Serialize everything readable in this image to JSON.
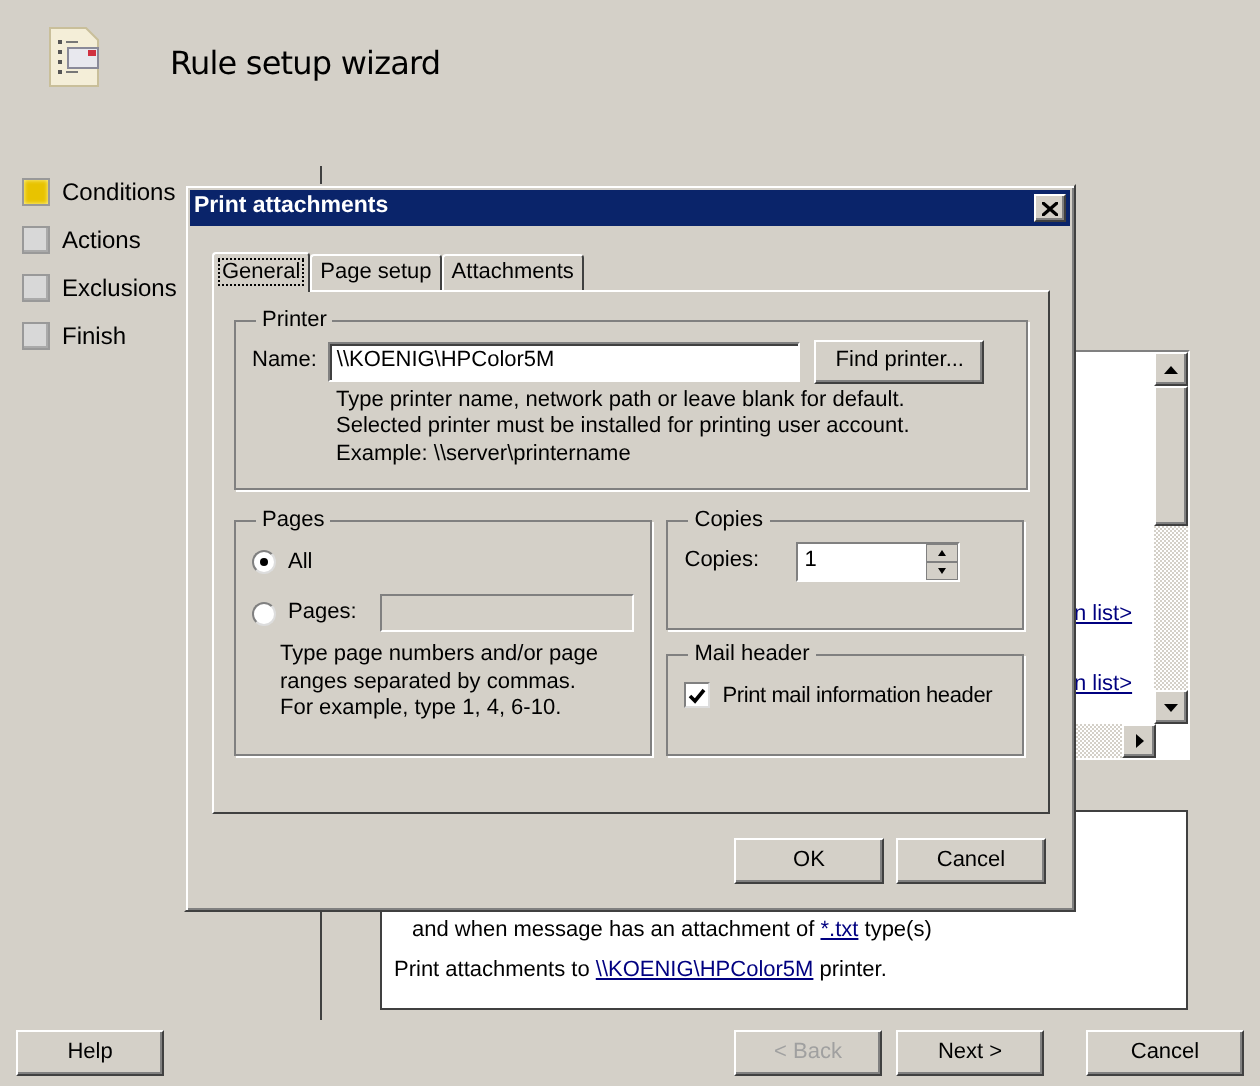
{
  "wizard": {
    "title": "Rule setup wizard",
    "steps": [
      {
        "label": "Conditions",
        "selected": true
      },
      {
        "label": "Actions",
        "selected": false
      },
      {
        "label": "Exclusions",
        "selected": false
      },
      {
        "label": "Finish",
        "selected": false
      }
    ],
    "list_links": [
      "n list>",
      "n list>"
    ],
    "summary": [
      {
        "indent": true,
        "before": "and when message has an attachment of ",
        "link": "*.txt",
        "after": " type(s)"
      },
      {
        "indent": false,
        "before": "Print attachments to ",
        "link": "\\\\KOENIG\\HPColor5M",
        "after": " printer."
      }
    ],
    "help_button": "Help",
    "nav_buttons": [
      {
        "label": "< Back",
        "disabled": true
      },
      {
        "label": "Next >",
        "disabled": false
      },
      {
        "label": "Cancel",
        "disabled": false
      }
    ]
  },
  "dialog": {
    "title": "Print attachments",
    "tabs": [
      {
        "label": "General",
        "selected": true
      },
      {
        "label": "Page setup",
        "selected": false
      },
      {
        "label": "Attachments",
        "selected": false
      }
    ],
    "printer": {
      "legend": "Printer",
      "name_label": "Name:",
      "name_value": "\\\\KOENIG\\HPColor5M",
      "find_button": "Find printer...",
      "hint": "Type printer name, network path or leave blank for default.\nSelected printer must be installed for printing user account.\nExample: \\\\server\\printername"
    },
    "pages": {
      "legend": "Pages",
      "options": [
        {
          "label": "All",
          "selected": true
        },
        {
          "label": "Pages:",
          "selected": false
        }
      ],
      "hint": "Type page numbers and/or page\nranges separated by commas.\nFor example, type 1, 4, 6-10."
    },
    "copies": {
      "legend": "Copies",
      "label": "Copies:",
      "value": "1"
    },
    "mail_header": {
      "legend": "Mail header",
      "label": "Print mail information header",
      "checked": true
    },
    "buttons": [
      "OK",
      "Cancel"
    ]
  }
}
